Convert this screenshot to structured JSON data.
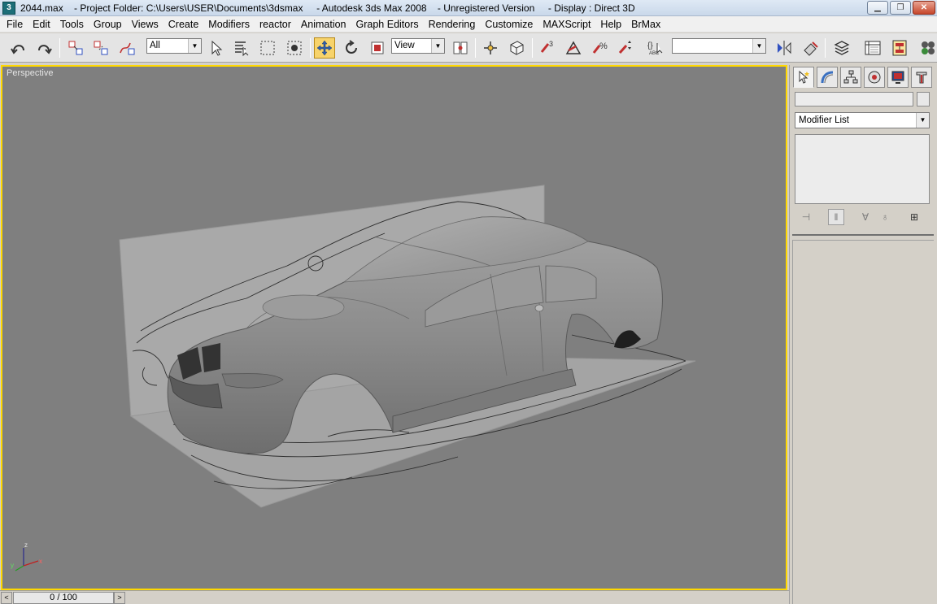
{
  "window": {
    "title": "2044.max    - Project Folder: C:\\Users\\USER\\Documents\\3dsmax     - Autodesk 3ds Max 2008    - Unregistered Version     - Display : Direct 3D",
    "icon_label": "3",
    "minimize_icon": "minimize-icon",
    "maximize_icon": "maximize-icon",
    "close_icon": "close-icon"
  },
  "menubar": {
    "items": [
      "File",
      "Edit",
      "Tools",
      "Group",
      "Views",
      "Create",
      "Modifiers",
      "reactor",
      "Animation",
      "Graph Editors",
      "Rendering",
      "Customize",
      "MAXScript",
      "Help",
      "BrMax"
    ]
  },
  "toolbar": {
    "selection_filter": "All",
    "reference_coord": "View",
    "named_selection": ""
  },
  "viewport": {
    "label": "Perspective",
    "axis_x": "x",
    "axis_y": "y",
    "axis_z": "z",
    "background_color": "#7f7f7f",
    "active_border_color": "#ffd800"
  },
  "command_panel": {
    "name_value": "",
    "modifier_list": "Modifier List"
  },
  "timeslider": {
    "frame": "0 / 100",
    "prev_label": "<",
    "next_label": ">"
  }
}
